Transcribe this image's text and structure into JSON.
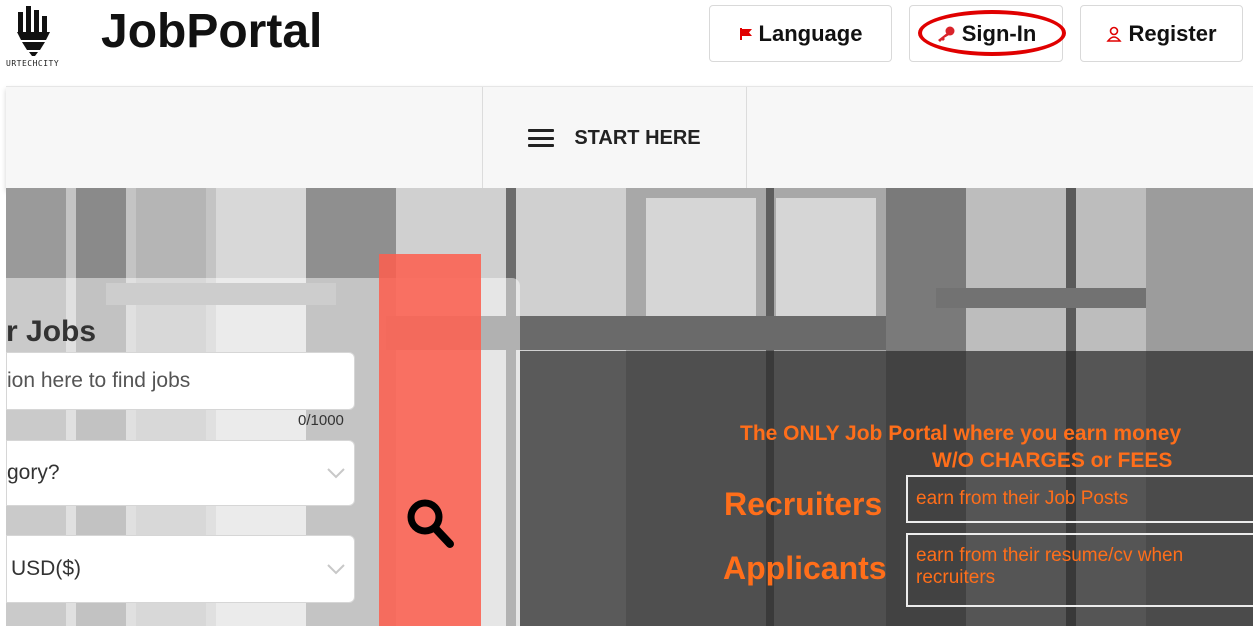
{
  "header": {
    "logo_text": "URTECHCITY",
    "brand": "JobPortal",
    "language_label": "Language",
    "signin_label": "Sign-In",
    "register_label": "Register",
    "icons": {
      "language": "flag-icon",
      "signin": "key-icon",
      "register": "user-icon"
    }
  },
  "nav": {
    "start_label": "START HERE",
    "menu_icon": "hamburger-icon"
  },
  "search": {
    "title": "r Jobs",
    "keyword_placeholder": "ion here to find jobs",
    "counter": "0/1000",
    "category_value": "gory?",
    "currency_value": "USD($)",
    "search_icon": "search-icon"
  },
  "promo": {
    "line1": "The ONLY Job Portal where you earn money",
    "line2": "W/O CHARGES or FEES",
    "rows": [
      {
        "role": "Recruiters",
        "desc": "earn from their Job Posts"
      },
      {
        "role": "Applicants",
        "desc": "earn from their resume/cv when recruiters"
      }
    ]
  },
  "colors": {
    "accent": "#ff6e1a",
    "search_column": "#fc6050",
    "annotation": "#e00000"
  }
}
